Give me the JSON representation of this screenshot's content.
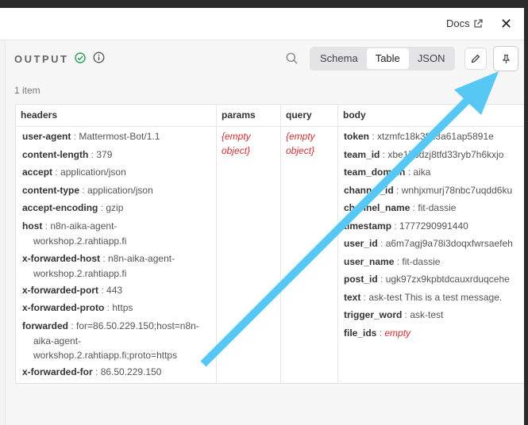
{
  "topbar": {
    "docs_label": "Docs",
    "close_glyph": "✕"
  },
  "panel": {
    "output_label": "OUTPUT",
    "item_count": "1 item",
    "tabs": [
      {
        "label": "Schema",
        "active": false
      },
      {
        "label": "Table",
        "active": true
      },
      {
        "label": "JSON",
        "active": false
      }
    ]
  },
  "table": {
    "columns": [
      "headers",
      "params",
      "query",
      "body"
    ],
    "headers": [
      {
        "key": "user-agent",
        "value": "Mattermost-Bot/1.1"
      },
      {
        "key": "content-length",
        "value": "379"
      },
      {
        "key": "accept",
        "value": "application/json"
      },
      {
        "key": "content-type",
        "value": "application/json"
      },
      {
        "key": "accept-encoding",
        "value": "gzip"
      },
      {
        "key": "host",
        "value": "n8n-aika-agent-",
        "value2": "workshop.2.rahtiapp.fi"
      },
      {
        "key": "x-forwarded-host",
        "value": "n8n-aika-agent-",
        "value2": "workshop.2.rahtiapp.fi"
      },
      {
        "key": "x-forwarded-port",
        "value": "443"
      },
      {
        "key": "x-forwarded-proto",
        "value": "https"
      },
      {
        "key": "forwarded",
        "value": "for=86.50.229.150;host=n8n-",
        "value2": "aika-agent-",
        "value3": "workshop.2.rahtiapp.fi;proto=https"
      },
      {
        "key": "x-forwarded-for",
        "value": "86.50.229.150"
      }
    ],
    "params_empty": [
      "{empty",
      "object}"
    ],
    "query_empty": [
      "{empty",
      "object}"
    ],
    "body": [
      {
        "key": "token",
        "value": "xtzmfc18k3f5i3a61ap5891e"
      },
      {
        "key": "team_id",
        "value": "xbe17bdzj8tfd33ryb7h6kxjo"
      },
      {
        "key": "team_domain",
        "value": "aika"
      },
      {
        "key": "channel_id",
        "value": "wnhjxmurj78nbc7uqdd6ku"
      },
      {
        "key": "channel_name",
        "value": "fit-dassie"
      },
      {
        "key": "timestamp",
        "value": "1777290991440"
      },
      {
        "key": "user_id",
        "value": "a6m7agj9a78i3doqxfwrsaefeh"
      },
      {
        "key": "user_name",
        "value": "fit-dassie"
      },
      {
        "key": "post_id",
        "value": "ugk97zx9kpbtdcauxrduqcehe"
      },
      {
        "key": "text",
        "value": "ask-test This is a test message."
      },
      {
        "key": "trigger_word",
        "value": "ask-test"
      },
      {
        "key": "file_ids",
        "value": "empty"
      }
    ]
  },
  "colors": {
    "arrow": "#56c8f3",
    "check": "#2e9e58",
    "empty_red": "#d0302f"
  }
}
